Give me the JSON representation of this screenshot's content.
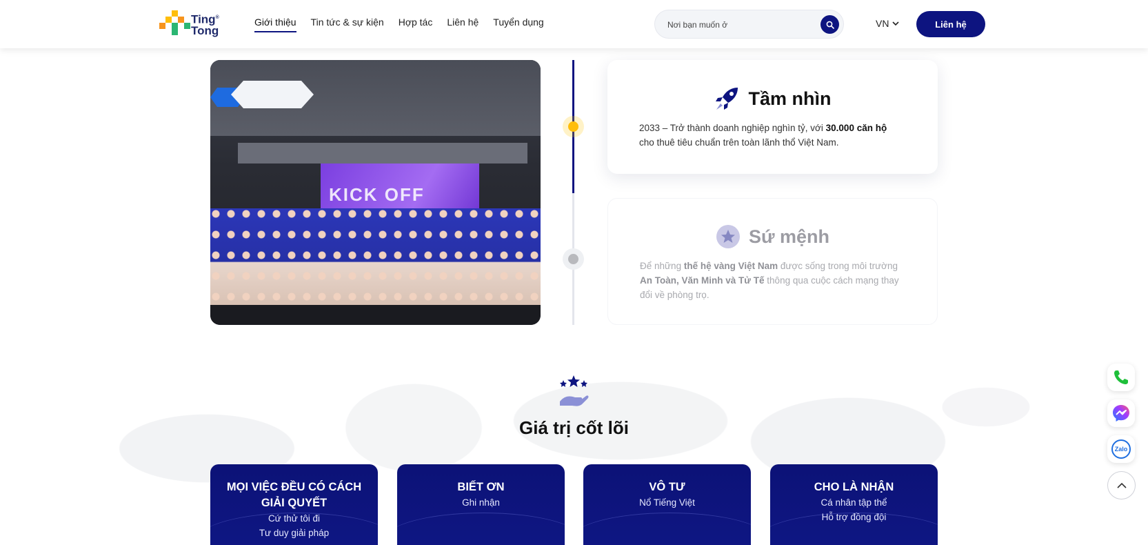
{
  "header": {
    "logo": {
      "line1": "Ting",
      "line2": "Tong",
      "colors": [
        "#ffbe0b",
        "#f7941d",
        "#2bb673",
        "#0d1480"
      ]
    },
    "nav": [
      {
        "label": "Giới thiệu",
        "active": true
      },
      {
        "label": "Tin tức & sự kiện"
      },
      {
        "label": "Hợp tác"
      },
      {
        "label": "Liên hệ"
      },
      {
        "label": "Tuyển dụng"
      }
    ],
    "search": {
      "placeholder": "Nơi bạn muốn ở",
      "icon": "search-icon"
    },
    "language": {
      "value": "VN",
      "icon": "chevron-down-icon"
    },
    "contact_button": "Liên hệ"
  },
  "hero_photo": {
    "screen_text": "KICK OFF"
  },
  "vision": {
    "title": "Tầm nhìn",
    "icon": "rocket-icon",
    "text_pre": "2033 – Trở thành doanh nghiệp nghìn tỷ, với ",
    "text_bold": "30.000 căn hộ",
    "text_post": "cho thuê tiêu chuẩn trên toàn lãnh thổ Việt Nam."
  },
  "mission": {
    "title": "Sứ mệnh",
    "icon": "star-badge-icon",
    "text_pre": "Để những ",
    "text_bold1": "thế hệ vàng Việt Nam",
    "text_mid": " được sống trong môi trường",
    "text_bold2": "An Toàn, Văn Minh và Tử Tế",
    "text_post": " thông qua cuộc cách mạng thay đổi về phòng trọ."
  },
  "core_values": {
    "title": "Giá trị cốt lõi",
    "icon": "hand-stars-icon",
    "cards": [
      {
        "title": "MỌI VIỆC ĐỀU CÓ CÁCH GIẢI QUYẾT",
        "lines": [
          "Cứ thử tôi đi",
          "Tư duy giải pháp"
        ]
      },
      {
        "title": "BIẾT ƠN",
        "lines": [
          "Ghi nhận"
        ]
      },
      {
        "title": "VÔ TƯ",
        "lines": [
          "Nổ Tiếng Việt"
        ]
      },
      {
        "title": "CHO LÀ NHẬN",
        "lines": [
          "Cá nhân tập thể",
          "Hỗ trợ đồng đội"
        ]
      }
    ]
  },
  "floating": {
    "phone_icon": "phone-icon",
    "messenger_icon": "messenger-icon",
    "zalo_label": "Zalo",
    "top_icon": "arrow-up-icon"
  },
  "colors": {
    "primary": "#0d1480",
    "accent": "#ffbe0b",
    "muted": "#a8a9ae"
  }
}
